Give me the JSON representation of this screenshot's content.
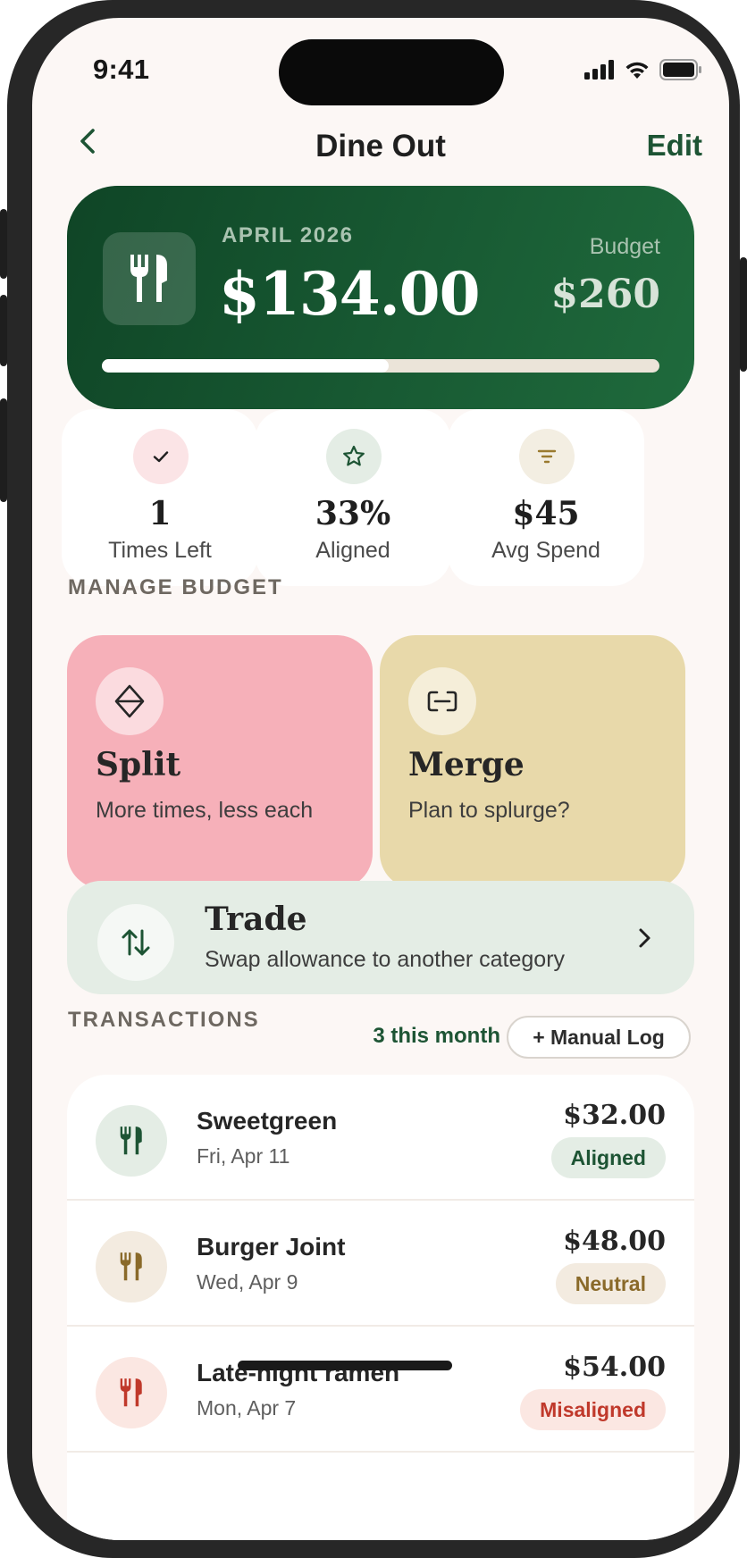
{
  "status_bar": {
    "time": "9:41"
  },
  "nav": {
    "title": "Dine Out",
    "edit_label": "Edit",
    "back_icon": "chevron-left-icon"
  },
  "hero": {
    "month_label": "APRIL 2026",
    "spent": "$134.00",
    "budget_label": "Budget",
    "budget_value": "$260",
    "progress_fraction": 0.515,
    "icon": "fork-knife-icon"
  },
  "stats": [
    {
      "value": "1",
      "label": "Times Left",
      "icon": "check-icon",
      "badge_color": "#fbe4e6",
      "icon_color": "#1f1f1f"
    },
    {
      "value": "33%",
      "label": "Aligned",
      "icon": "star-icon",
      "badge_color": "#e4ede5",
      "icon_color": "#1d5434"
    },
    {
      "value": "$45",
      "label": "Avg Spend",
      "icon": "filter-icon",
      "badge_color": "#f3eee2",
      "icon_color": "#9a7a2e"
    }
  ],
  "manage": {
    "section_label": "MANAGE BUDGET",
    "split": {
      "title": "Split",
      "subtitle": "More times, less each",
      "color": "#f6b0b9",
      "icon": "split-icon"
    },
    "merge": {
      "title": "Merge",
      "subtitle": "Plan to splurge?",
      "color": "#e8d9aa",
      "icon": "merge-icon"
    },
    "trade": {
      "title": "Trade",
      "subtitle": "Swap allowance to another category",
      "icon": "swap-arrows-icon"
    }
  },
  "transactions": {
    "section_label": "TRANSACTIONS",
    "count_label": "3 this month",
    "manual_log_label": "+ Manual Log",
    "items": [
      {
        "name": "Sweetgreen",
        "date": "Fri, Apr 11",
        "amount": "$32.00",
        "status": "Aligned",
        "icon_bg": "#e4ede5",
        "icon_color": "#1d5434",
        "badge_bg": "#e4ede5",
        "badge_color": "#1d5434"
      },
      {
        "name": "Burger Joint",
        "date": "Wed, Apr 9",
        "amount": "$48.00",
        "status": "Neutral",
        "icon_bg": "#f3ebe0",
        "icon_color": "#8a6a2a",
        "badge_bg": "#f3ebe0",
        "badge_color": "#8a6a2a"
      },
      {
        "name": "Late-night ramen",
        "date": "Mon, Apr 7",
        "amount": "$54.00",
        "status": "Misaligned",
        "icon_bg": "#fbe7e2",
        "icon_color": "#c0392b",
        "badge_bg": "#fbe7e2",
        "badge_color": "#c0392b"
      }
    ]
  }
}
